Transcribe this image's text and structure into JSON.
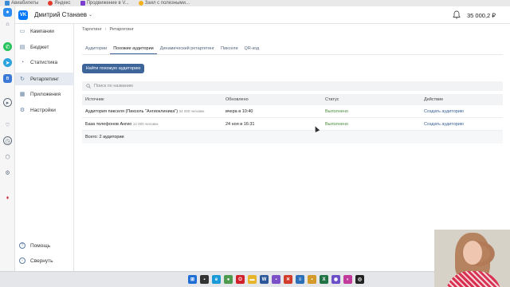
{
  "bookmarks": [
    {
      "label": "Авиабилеты",
      "color": "#3b8bd6"
    },
    {
      "label": "Яндекс",
      "color": "#e33b2e"
    },
    {
      "label": "Продвижение в V...",
      "color": "#7a3fd1"
    },
    {
      "label": "Заял с полезными...",
      "color": "#f3b21b"
    }
  ],
  "header": {
    "logo": "VK",
    "account_name": "Дмитрий Станаев",
    "balance": "35 000,2 ₽"
  },
  "nav": {
    "items": [
      {
        "label": "Кампании",
        "icon": "campaign-icon"
      },
      {
        "label": "Бюджет",
        "icon": "wallet-icon"
      },
      {
        "label": "Статистика",
        "icon": "chart-icon"
      },
      {
        "label": "Ретаргетинг",
        "icon": "target-icon",
        "active": true
      },
      {
        "label": "Приложения",
        "icon": "apps-icon"
      },
      {
        "label": "Настройки",
        "icon": "gear-icon"
      }
    ],
    "help_label": "Помощь",
    "collapse_label": "Свернуть"
  },
  "breadcrumb": {
    "root": "Таргетинг",
    "current": "Ретаргетинг"
  },
  "tabs": [
    {
      "label": "Аудитории"
    },
    {
      "label": "Похожие аудитории",
      "active": true
    },
    {
      "label": "Динамический ретаргетинг"
    },
    {
      "label": "Пиксели"
    },
    {
      "label": "QR-код"
    }
  ],
  "find_button": "Найти похожую аудиторию",
  "search": {
    "placeholder": "Поиск по названию",
    "value": ""
  },
  "table": {
    "headers": [
      "Источник",
      "Обновлено",
      "Статус",
      "Действие"
    ],
    "rows": [
      {
        "source": "Аудитория пикселя (Пиксель \"Ангиоклиника\")",
        "count": "34 000 человек",
        "updated": "вчера в 10:40",
        "status": "Выполнено",
        "action": "Создать аудиторию"
      },
      {
        "source": "База телефонов Ангио",
        "count": "12 000 человек",
        "updated": "24 ноя в 16:31",
        "status": "Выполнено",
        "action": "Создать аудиторию"
      }
    ],
    "total": "Всего: 2 аудитории"
  },
  "colors": {
    "accent": "#3d6599",
    "vk_blue": "#0077ff",
    "status_ok": "#4b8a3c",
    "link": "#3a6196"
  },
  "taskbar_icons": [
    {
      "name": "windows-start-icon",
      "color": "#1f6fd6",
      "glyph": "⊞"
    },
    {
      "name": "search-taskbar-icon",
      "color": "#333333",
      "glyph": "▪"
    },
    {
      "name": "edge-icon",
      "color": "#1a9bd7",
      "glyph": "e"
    },
    {
      "name": "chrome-icon",
      "color": "#4e9a4f",
      "glyph": "●"
    },
    {
      "name": "opera-icon",
      "color": "#d0202c",
      "glyph": "O"
    },
    {
      "name": "folder-icon",
      "color": "#e7b52c",
      "glyph": "▬"
    },
    {
      "name": "word-icon",
      "color": "#2b579a",
      "glyph": "W"
    },
    {
      "name": "app-icon",
      "color": "#7a4fc8",
      "glyph": "▪"
    },
    {
      "name": "close-app-icon",
      "color": "#d13c2b",
      "glyph": "✕"
    },
    {
      "name": "notes-icon",
      "color": "#2c6fb8",
      "glyph": "≡"
    },
    {
      "name": "explorer-icon",
      "color": "#d39a2a",
      "glyph": "▪"
    },
    {
      "name": "excel-icon",
      "color": "#217346",
      "glyph": "X"
    },
    {
      "name": "viber-icon",
      "color": "#6c4fc7",
      "glyph": "◉"
    },
    {
      "name": "paint-icon",
      "color": "#c1399b",
      "glyph": "◐"
    },
    {
      "name": "media-icon",
      "color": "#222222",
      "glyph": "◎"
    }
  ]
}
